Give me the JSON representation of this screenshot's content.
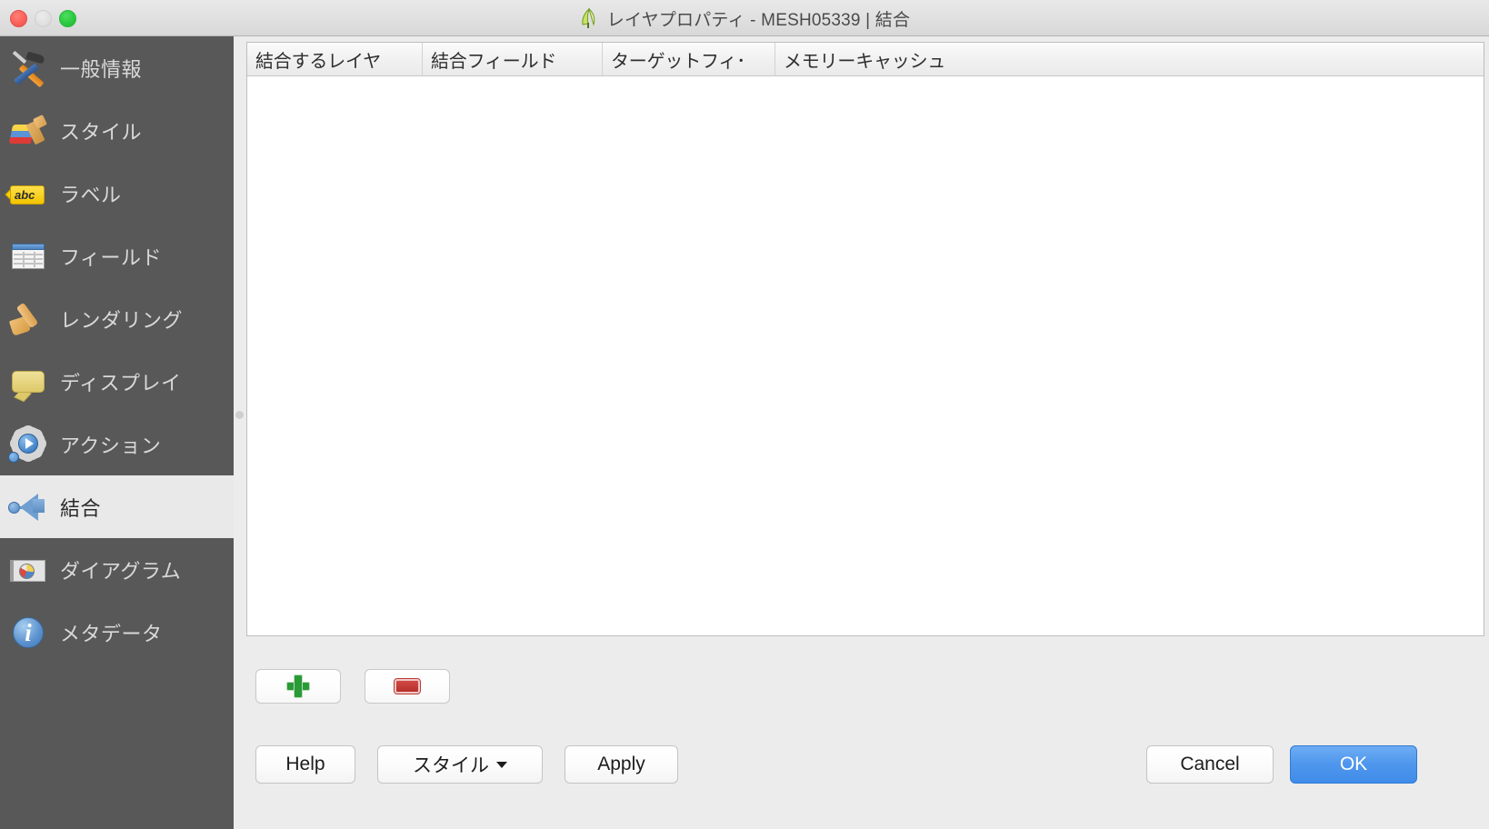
{
  "window": {
    "title": "レイヤプロパティ - MESH05339 | 結合",
    "app_icon": "qgis-logo-icon",
    "controls": {
      "close": "close-button",
      "minimize": "minimize-button",
      "maximize": "maximize-button"
    }
  },
  "sidebar": {
    "items": [
      {
        "label": "一般情報",
        "icon": "hammer-screwdriver-icon",
        "selected": false
      },
      {
        "label": "スタイル",
        "icon": "paint-brush-color-icon",
        "selected": false
      },
      {
        "label": "ラベル",
        "icon": "abc-label-tag-icon",
        "selected": false
      },
      {
        "label": "フィールド",
        "icon": "table-grid-icon",
        "selected": false
      },
      {
        "label": "レンダリング",
        "icon": "render-brush-icon",
        "selected": false
      },
      {
        "label": "ディスプレイ",
        "icon": "speech-bubble-icon",
        "selected": false
      },
      {
        "label": "アクション",
        "icon": "gear-play-icon",
        "selected": false
      },
      {
        "label": "結合",
        "icon": "join-arrow-icon",
        "selected": true
      },
      {
        "label": "ダイアグラム",
        "icon": "pie-chart-map-icon",
        "selected": false
      },
      {
        "label": "メタデータ",
        "icon": "info-circle-icon",
        "selected": false
      }
    ]
  },
  "main": {
    "joins_table": {
      "columns": [
        "結合するレイヤ",
        "結合フィールド",
        "ターゲットフィ･",
        "メモリーキャッシュ"
      ],
      "rows": []
    },
    "row_toolbar": {
      "add_label": "add-join-button",
      "remove_label": "remove-join-button"
    }
  },
  "buttons": {
    "help": "Help",
    "style": "スタイル",
    "style_caret": "▾",
    "apply": "Apply",
    "cancel": "Cancel",
    "ok": "OK"
  },
  "colors": {
    "sidebar_bg": "#585858",
    "selected_bg": "#e9e9e9",
    "dialog_bg": "#ececec",
    "ok_button": "#4f97ed",
    "table_bg": "#ffffff"
  }
}
